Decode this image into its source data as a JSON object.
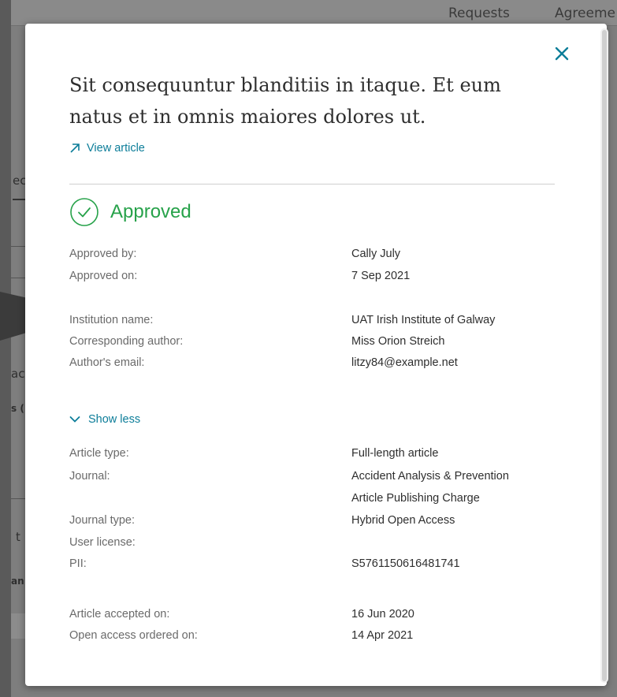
{
  "background": {
    "nav": [
      "Requests",
      "Agreeme"
    ],
    "fragments": [
      "ec",
      "ac",
      "s (",
      "t",
      "an"
    ]
  },
  "modal": {
    "close_label": "✕",
    "title": "Sit consequuntur blanditiis in itaque. Et eum natus et in omnis maiores dolores ut.",
    "view_article_label": "View article",
    "status": {
      "label": "Approved",
      "color": "#27a24a"
    },
    "approval": [
      {
        "label": "Approved by:",
        "value": "Cally July"
      },
      {
        "label": "Approved on:",
        "value": "7 Sep 2021"
      }
    ],
    "institution": [
      {
        "label": "Institution name:",
        "value": "UAT Irish Institute of Galway"
      },
      {
        "label": "Corresponding author:",
        "value": "Miss Orion Streich"
      },
      {
        "label": "Author's email:",
        "value": "litzy84@example.net"
      }
    ],
    "toggle_label": "Show less",
    "article_details": {
      "article_type_label": "Article type:",
      "article_type_value": "Full-length article",
      "journal_label": "Journal:",
      "journal_value": "Accident Analysis & Prevention",
      "publishing_charge_value": "Article Publishing Charge",
      "journal_type_label": "Journal type:",
      "journal_type_value": "Hybrid Open Access",
      "user_license_label": "User license:",
      "pii_label": "PII:",
      "pii_value": "S5761150616481741"
    },
    "dates": [
      {
        "label": "Article accepted on:",
        "value": "16 Jun 2020"
      },
      {
        "label": "Open access ordered on:",
        "value": "14 Apr 2021"
      }
    ],
    "accent_color": "#0c7d99"
  }
}
